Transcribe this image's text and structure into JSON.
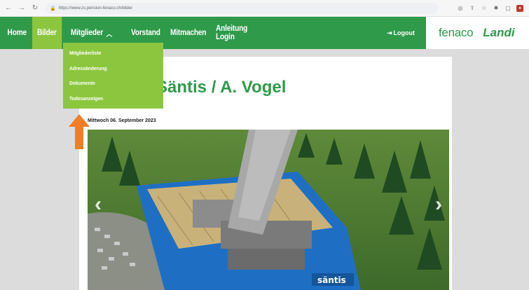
{
  "browser": {
    "url": "https://www.zs.pension-fenaco.ch/bilder"
  },
  "nav": {
    "home": "Home",
    "bilder": "Bilder",
    "mitglieder": "Mitglieder",
    "vorstand": "Vorstand",
    "mitmachen": "Mitmachen",
    "anleitung_login": "Anleitung Login",
    "logout": "Logout"
  },
  "brand": {
    "fenaco": "fenaco",
    "landi": "Landi"
  },
  "dropdown": {
    "items": [
      "Mitgliederliste",
      "Adressänderung",
      "Dokumente",
      "Todesanzeigen"
    ]
  },
  "article": {
    "title": "Säntis / A. Vogel",
    "date": "Mittwoch 06. September 2023"
  },
  "colors": {
    "header_green": "#2e9a4a",
    "active_green": "#8cc63f",
    "arrow_orange": "#f07e26"
  }
}
